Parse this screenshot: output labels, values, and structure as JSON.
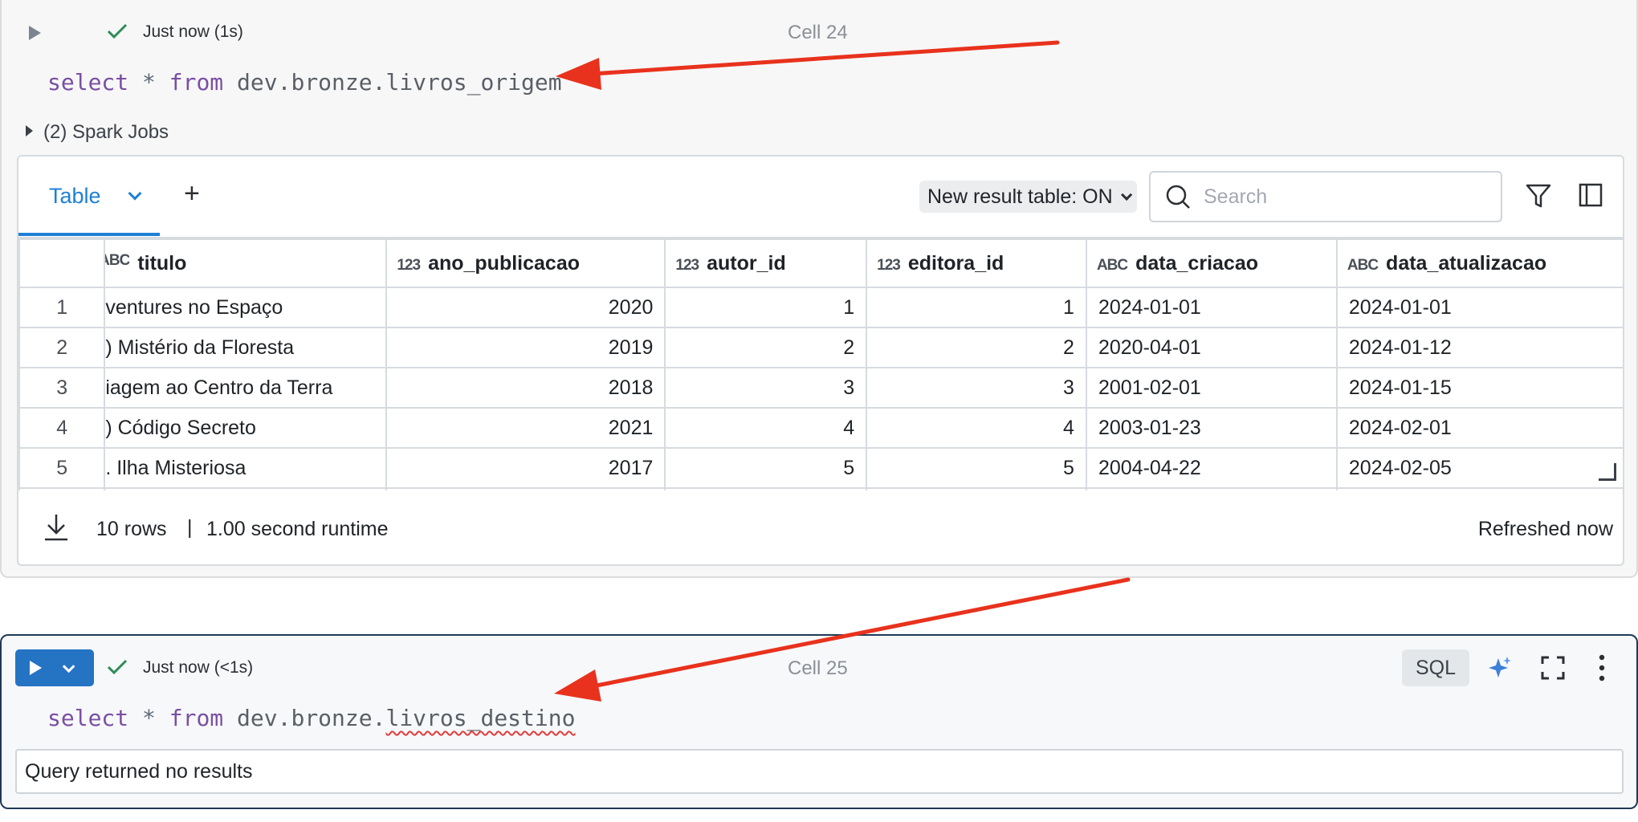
{
  "cell24": {
    "status": "Just now (1s)",
    "label": "Cell 24",
    "code": {
      "kw1": "select",
      "op": "*",
      "kw2": "from",
      "target": "dev.bronze.livros_origem"
    },
    "spark_jobs": "(2) Spark Jobs",
    "results": {
      "tab_label": "Table",
      "new_result_table": "New result table: ON",
      "search_placeholder": "Search",
      "columns": [
        {
          "type": "ABC",
          "name": "titulo"
        },
        {
          "type": "123",
          "name": "ano_publicacao"
        },
        {
          "type": "123",
          "name": "autor_id"
        },
        {
          "type": "123",
          "name": "editora_id"
        },
        {
          "type": "ABC",
          "name": "data_criacao"
        },
        {
          "type": "ABC",
          "name": "data_atualizacao"
        }
      ],
      "rows": [
        {
          "idx": "1",
          "titulo": "ventures no Espaço",
          "ano_publicacao": "2020",
          "autor_id": "1",
          "editora_id": "1",
          "data_criacao": "2024-01-01",
          "data_atualizacao": "2024-01-01"
        },
        {
          "idx": "2",
          "titulo": ") Mistério da Floresta",
          "ano_publicacao": "2019",
          "autor_id": "2",
          "editora_id": "2",
          "data_criacao": "2020-04-01",
          "data_atualizacao": "2024-01-12"
        },
        {
          "idx": "3",
          "titulo": "iagem ao Centro da Terra",
          "ano_publicacao": "2018",
          "autor_id": "3",
          "editora_id": "3",
          "data_criacao": "2001-02-01",
          "data_atualizacao": "2024-01-15"
        },
        {
          "idx": "4",
          "titulo": ") Código Secreto",
          "ano_publicacao": "2021",
          "autor_id": "4",
          "editora_id": "4",
          "data_criacao": "2003-01-23",
          "data_atualizacao": "2024-02-01"
        },
        {
          "idx": "5",
          "titulo": ". Ilha Misteriosa",
          "ano_publicacao": "2017",
          "autor_id": "5",
          "editora_id": "5",
          "data_criacao": "2004-04-22",
          "data_atualizacao": "2024-02-05"
        }
      ],
      "footer": {
        "rows": "10 rows",
        "separator": "|",
        "runtime": "1.00 second runtime",
        "refreshed": "Refreshed now"
      }
    }
  },
  "cell25": {
    "status": "Just now (<1s)",
    "label": "Cell 25",
    "language": "SQL",
    "code": {
      "kw1": "select",
      "op": "*",
      "kw2": "from",
      "prefix": "dev.bronze.",
      "table": "livros_destino"
    },
    "message": "Query returned no results"
  },
  "colors": {
    "accent": "#1e80d6",
    "run_button": "#2574c4",
    "success": "#2e8b57",
    "annotation_arrow": "#e8321d",
    "keyword": "#7a4fa3"
  }
}
